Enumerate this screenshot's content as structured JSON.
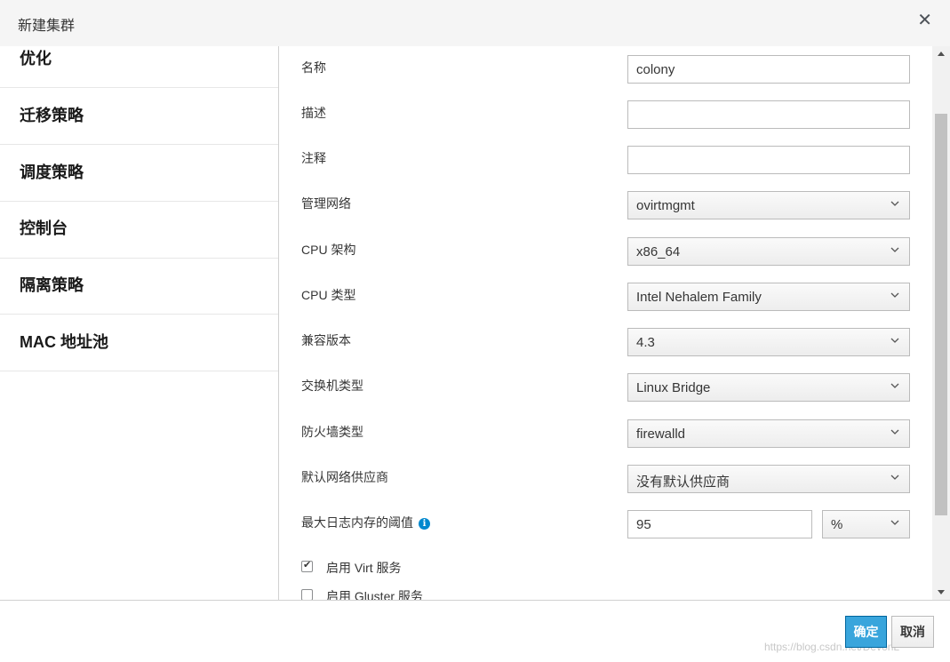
{
  "dialog": {
    "title": "新建集群",
    "close_glyph": "✕"
  },
  "sidebar": {
    "items": [
      {
        "label": "优化"
      },
      {
        "label": "迁移策略"
      },
      {
        "label": "调度策略"
      },
      {
        "label": "控制台"
      },
      {
        "label": "隔离策略"
      },
      {
        "label": "MAC 地址池"
      }
    ]
  },
  "form": {
    "name": {
      "label": "名称",
      "value": "colony"
    },
    "description": {
      "label": "描述",
      "value": ""
    },
    "comment": {
      "label": "注释",
      "value": ""
    },
    "management_network": {
      "label": "管理网络",
      "value": "ovirtmgmt"
    },
    "cpu_arch": {
      "label": "CPU 架构",
      "value": "x86_64"
    },
    "cpu_type": {
      "label": "CPU 类型",
      "value": "Intel Nehalem Family"
    },
    "compat_version": {
      "label": "兼容版本",
      "value": "4.3"
    },
    "switch_type": {
      "label": "交换机类型",
      "value": "Linux Bridge"
    },
    "firewall_type": {
      "label": "防火墙类型",
      "value": "firewalld"
    },
    "default_network_provider": {
      "label": "默认网络供应商",
      "value": "没有默认供应商"
    },
    "max_log_memory": {
      "label": "最大日志内存的阈值",
      "value": "95",
      "unit": "%",
      "info_glyph": "i"
    },
    "enable_virt": {
      "label": "启用 Virt 服务",
      "checked": true
    },
    "enable_gluster": {
      "label": "启用 Gluster 服务",
      "checked": false
    }
  },
  "footer": {
    "ok_label": "确定",
    "cancel_label": "取消",
    "watermark": "https://blog.csdn.net/DevonL"
  },
  "colors": {
    "primary_button": "#39a5dc",
    "info_icon": "#0088ce"
  }
}
